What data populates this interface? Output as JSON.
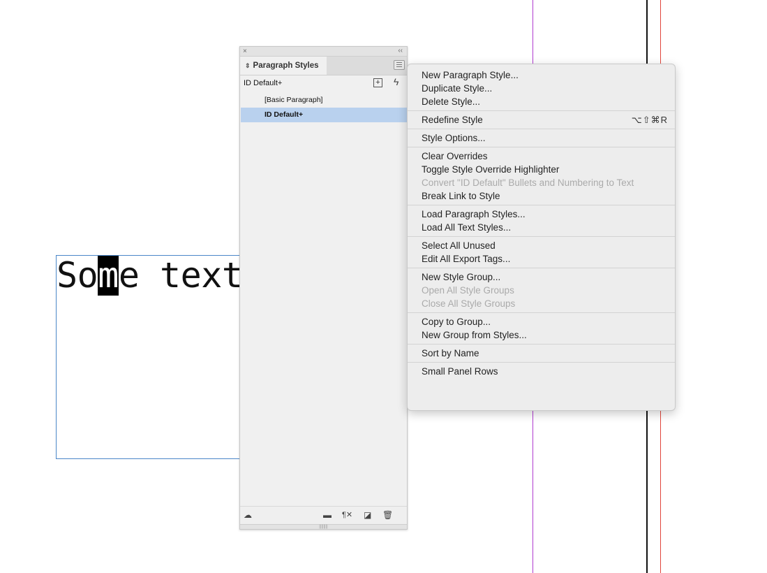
{
  "document": {
    "text_before": "So",
    "text_selected": "m",
    "text_after": "e text"
  },
  "panel": {
    "close_glyph": "×",
    "collapse_glyph": "‹‹",
    "tab_label": "Paragraph Styles",
    "current_style": "ID Default+",
    "styles": [
      {
        "label": "[Basic Paragraph]",
        "selected": false
      },
      {
        "label": "ID Default+",
        "selected": true
      }
    ]
  },
  "context_menu": {
    "groups": [
      [
        {
          "label": "New Paragraph Style...",
          "enabled": true
        },
        {
          "label": "Duplicate Style...",
          "enabled": true
        },
        {
          "label": "Delete Style...",
          "enabled": true
        }
      ],
      [
        {
          "label": "Redefine Style",
          "enabled": true,
          "shortcut": "⌥⇧⌘R"
        }
      ],
      [
        {
          "label": "Style Options...",
          "enabled": true
        }
      ],
      [
        {
          "label": "Clear Overrides",
          "enabled": true
        },
        {
          "label": "Toggle Style Override Highlighter",
          "enabled": true
        },
        {
          "label": "Convert \"ID Default\" Bullets and Numbering to Text",
          "enabled": false
        },
        {
          "label": "Break Link to Style",
          "enabled": true
        }
      ],
      [
        {
          "label": "Load Paragraph Styles...",
          "enabled": true
        },
        {
          "label": "Load All Text Styles...",
          "enabled": true
        }
      ],
      [
        {
          "label": "Select All Unused",
          "enabled": true
        },
        {
          "label": "Edit All Export Tags...",
          "enabled": true
        }
      ],
      [
        {
          "label": "New Style Group...",
          "enabled": true
        },
        {
          "label": "Open All Style Groups",
          "enabled": false
        },
        {
          "label": "Close All Style Groups",
          "enabled": false
        }
      ],
      [
        {
          "label": "Copy to Group...",
          "enabled": true
        },
        {
          "label": "New Group from Styles...",
          "enabled": true
        }
      ],
      [
        {
          "label": "Sort by Name",
          "enabled": true
        }
      ],
      [
        {
          "label": "Small Panel Rows",
          "enabled": true
        }
      ]
    ]
  },
  "colors": {
    "selection_highlight": "#b9d1ee",
    "frame_border": "#4a86c8",
    "guide_purple": "#b03ad0",
    "guide_red": "#e0453a"
  },
  "icons": [
    "close-icon",
    "collapse-icon",
    "panel-menu-icon",
    "new-style-icon",
    "quick-apply-icon",
    "cc-libraries-icon",
    "folder-icon",
    "clear-overrides-icon",
    "new-page-icon",
    "trash-icon",
    "resize-grip-icon"
  ]
}
